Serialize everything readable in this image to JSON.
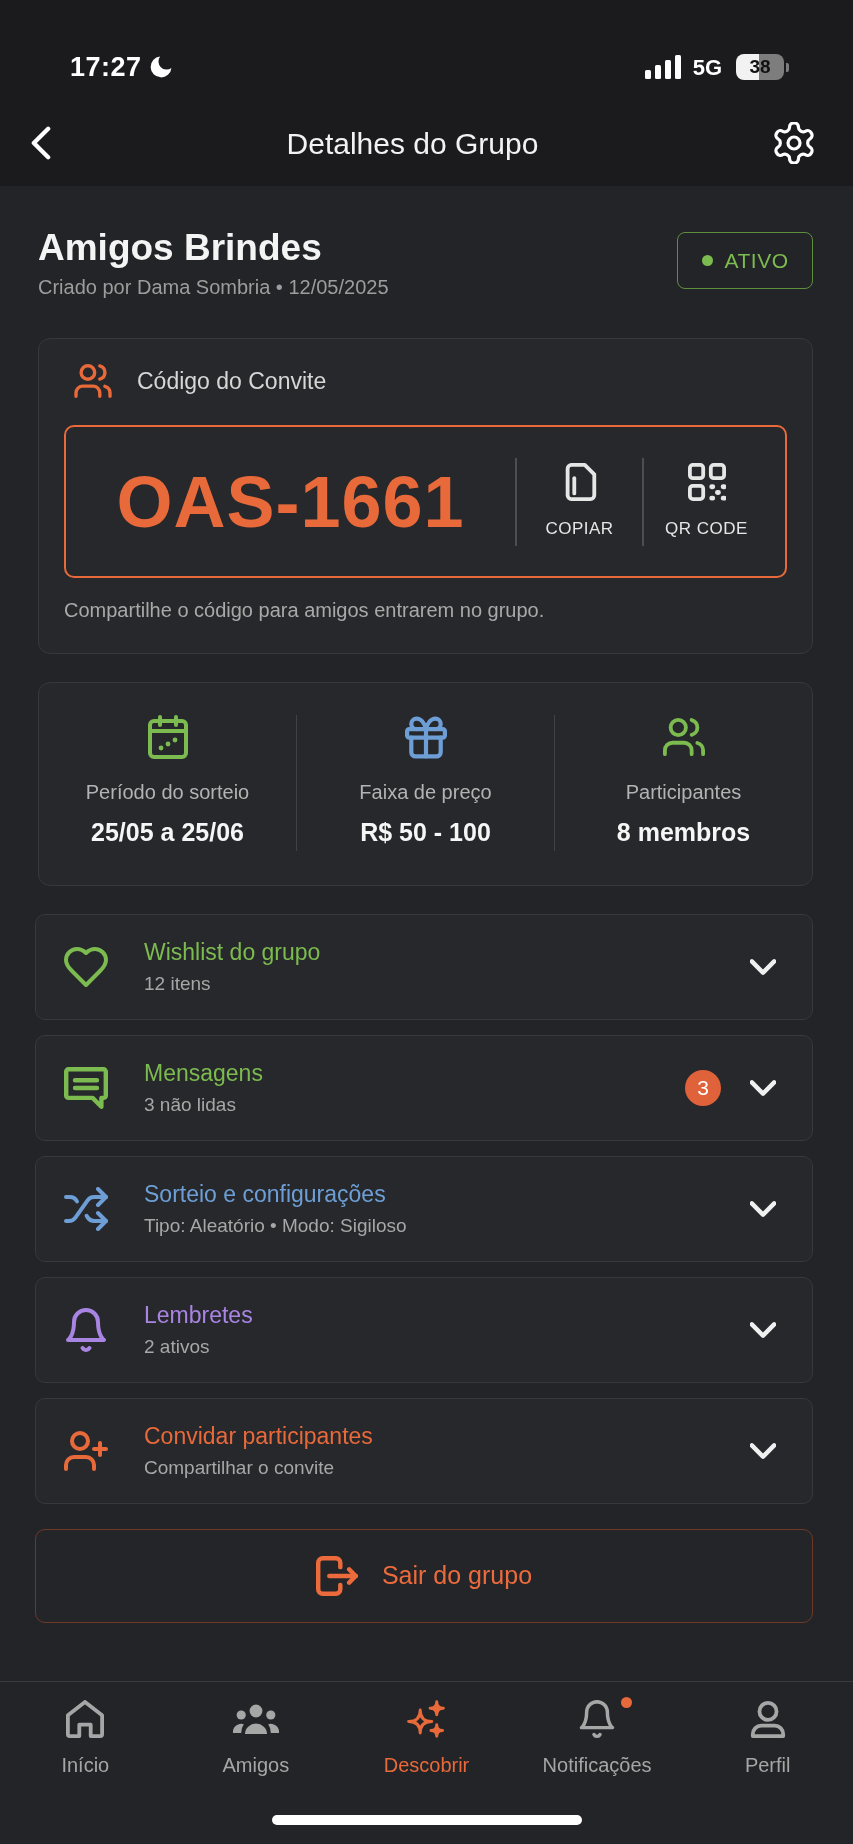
{
  "status_bar": {
    "time": "17:27",
    "network": "5G",
    "battery": "38"
  },
  "header": {
    "title": "Detalhes do Grupo"
  },
  "group": {
    "name": "Amigos Brindes",
    "meta": "Criado por Dama Sombria • 12/05/2025",
    "status": "ATIVO"
  },
  "invite": {
    "title": "Código do Convite",
    "code": "OAS-1661",
    "actions": [
      {
        "kind": "copy",
        "label": "COPIAR"
      },
      {
        "kind": "qr",
        "label": "QR CODE"
      }
    ],
    "hint": "Compartilhe o código para amigos entrarem no grupo."
  },
  "stats": [
    {
      "kind": "calendar",
      "color": "#7cbb4f",
      "label": "Período do sorteio",
      "value": "25/05 a 25/06"
    },
    {
      "kind": "gift",
      "color": "#6d9fd6",
      "label": "Faixa de preço",
      "value": "R$ 50 - 100"
    },
    {
      "kind": "people",
      "color": "#7cbb4f",
      "label": "Participantes",
      "value": "8 membros"
    }
  ],
  "sections": [
    {
      "kind": "heart",
      "color": "#7cbb4f",
      "title": "Wishlist do grupo",
      "subtitle": "12 itens",
      "expanded": false
    },
    {
      "kind": "message",
      "color": "#7cbb4f",
      "title": "Mensagens",
      "subtitle": "3 não lidas",
      "badge": "3",
      "expanded": false
    },
    {
      "kind": "shuffle",
      "color": "#6d9fd6",
      "title": "Sorteio e configurações",
      "subtitle": "Tipo: Aleatório • Modo: Sigiloso",
      "expanded": false
    },
    {
      "kind": "bell",
      "color": "#a884e3",
      "title": "Lembretes",
      "subtitle": "2 ativos",
      "expanded": false
    },
    {
      "kind": "person_plus",
      "color": "#e8693a",
      "title": "Convidar participantes",
      "subtitle": "Compartilhar o convite",
      "expanded": false
    }
  ],
  "leave_button": {
    "label": "Sair do grupo"
  },
  "bottom_nav": [
    {
      "kind": "home",
      "label": "Início",
      "selected": false,
      "dot": false
    },
    {
      "kind": "friends",
      "label": "Amigos",
      "selected": false,
      "dot": false
    },
    {
      "kind": "sparkle",
      "label": "Descobrir",
      "selected": true,
      "dot": false
    },
    {
      "kind": "bell",
      "label": "Notificações",
      "selected": false,
      "dot": true
    },
    {
      "kind": "person",
      "label": "Perfil",
      "selected": false,
      "dot": false
    }
  ]
}
